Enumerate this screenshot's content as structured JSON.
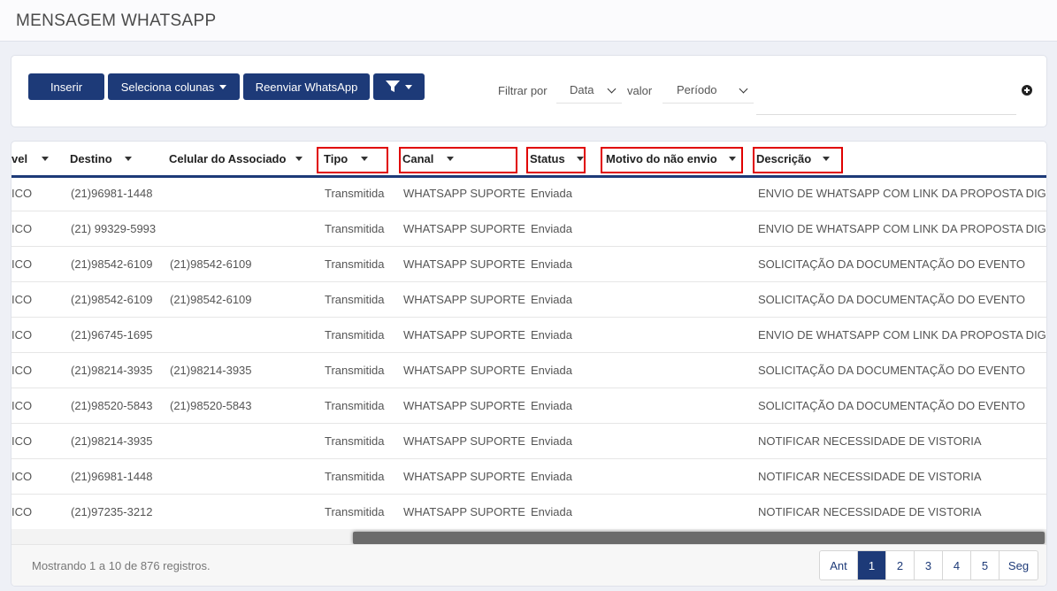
{
  "page": {
    "title": "MENSAGEM WHATSAPP"
  },
  "toolbar": {
    "insert_label": "Inserir",
    "columns_label": "Seleciona colunas",
    "resend_label": "Reenviar WhatsApp",
    "filter_icon": "filter-icon"
  },
  "filter": {
    "filter_by_label": "Filtrar por",
    "field_value": "Data",
    "value_label": "valor",
    "period_value": "Período",
    "value_input": ""
  },
  "table": {
    "columns": [
      "vel",
      "Destino",
      "Celular do Associado",
      "Tipo",
      "Canal",
      "Status",
      "Motivo do não envio",
      "Descrição"
    ],
    "rows": [
      [
        "ICO",
        "(21)96981-1448",
        "",
        "Transmitida",
        "WHATSAPP SUPORTE",
        "Enviada",
        "",
        "ENVIO DE WHATSAPP COM LINK DA PROPOSTA DIGITAL"
      ],
      [
        "ICO",
        "(21) 99329-5993",
        "",
        "Transmitida",
        "WHATSAPP SUPORTE",
        "Enviada",
        "",
        "ENVIO DE WHATSAPP COM LINK DA PROPOSTA DIGITAL"
      ],
      [
        "ICO",
        "(21)98542-6109",
        "(21)98542-6109",
        "Transmitida",
        "WHATSAPP SUPORTE",
        "Enviada",
        "",
        "SOLICITAÇÃO DA DOCUMENTAÇÃO DO EVENTO"
      ],
      [
        "ICO",
        "(21)98542-6109",
        "(21)98542-6109",
        "Transmitida",
        "WHATSAPP SUPORTE",
        "Enviada",
        "",
        "SOLICITAÇÃO DA DOCUMENTAÇÃO DO EVENTO"
      ],
      [
        "ICO",
        "(21)96745-1695",
        "",
        "Transmitida",
        "WHATSAPP SUPORTE",
        "Enviada",
        "",
        "ENVIO DE WHATSAPP COM LINK DA PROPOSTA DIGITAL"
      ],
      [
        "ICO",
        "(21)98214-3935",
        "(21)98214-3935",
        "Transmitida",
        "WHATSAPP SUPORTE",
        "Enviada",
        "",
        "SOLICITAÇÃO DA DOCUMENTAÇÃO DO EVENTO"
      ],
      [
        "ICO",
        "(21)98520-5843",
        "(21)98520-5843",
        "Transmitida",
        "WHATSAPP SUPORTE",
        "Enviada",
        "",
        "SOLICITAÇÃO DA DOCUMENTAÇÃO DO EVENTO"
      ],
      [
        "ICO",
        "(21)98214-3935",
        "",
        "Transmitida",
        "WHATSAPP SUPORTE",
        "Enviada",
        "",
        "NOTIFICAR NECESSIDADE DE VISTORIA"
      ],
      [
        "ICO",
        "(21)96981-1448",
        "",
        "Transmitida",
        "WHATSAPP SUPORTE",
        "Enviada",
        "",
        "NOTIFICAR NECESSIDADE DE VISTORIA"
      ],
      [
        "ICO",
        "(21)97235-3212",
        "",
        "Transmitida",
        "WHATSAPP SUPORTE",
        "Enviada",
        "",
        "NOTIFICAR NECESSIDADE DE VISTORIA"
      ]
    ]
  },
  "footer": {
    "info": "Mostrando 1 a 10 de 876 registros.",
    "pages": [
      "Ant",
      "1",
      "2",
      "3",
      "4",
      "5",
      "Seg"
    ],
    "current_page": "1"
  },
  "colors": {
    "primary": "#1d3a78",
    "highlight": "#e00000"
  }
}
